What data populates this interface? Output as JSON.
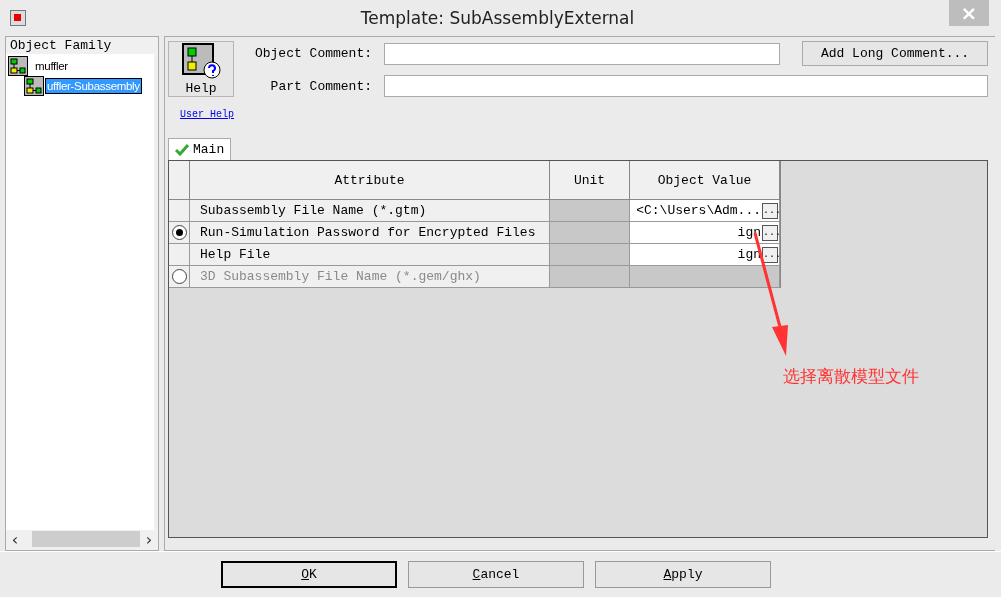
{
  "window": {
    "title": "Template: SubAssemblyExternal",
    "close": "×"
  },
  "family": {
    "title": "Object Family",
    "tree": [
      {
        "label": "muffler",
        "selected": false,
        "children": [
          {
            "label": "uffler-Subassembly",
            "selected": true
          }
        ]
      }
    ],
    "scroll_left": "‹",
    "scroll_right": "›"
  },
  "help": {
    "button": "Help",
    "link": "User Help"
  },
  "fields": [
    {
      "label": "Object Comment:"
    },
    {
      "label": "Part Comment:"
    }
  ],
  "long_comment_button": "Add Long Comment...",
  "tabs": [
    {
      "label": "Main",
      "selected": true
    }
  ],
  "table": {
    "columns": [
      "Attribute",
      "Unit",
      "Object Value"
    ],
    "rows": [
      {
        "kind": "plain",
        "attribute": "Subassembly File Name (*.gtm)",
        "value": "<C:\\Users\\Adm...",
        "browse": "...",
        "disabled": false
      },
      {
        "kind": "radio",
        "selected": true,
        "attribute": "Run-Simulation Password for Encrypted Files",
        "value": "ign",
        "browse": "...",
        "disabled": false
      },
      {
        "kind": "plain",
        "attribute": "Help File",
        "value": "ign",
        "browse": "...",
        "disabled": false
      },
      {
        "kind": "radio",
        "selected": false,
        "attribute": "3D Subassembly File Name (*.gem/ghx)",
        "disabled": true
      }
    ]
  },
  "annotation": {
    "text": "选择离散模型文件",
    "color": "#ff3333"
  },
  "buttons": [
    {
      "label": "OK",
      "default": true
    },
    {
      "label": "Cancel",
      "default": false
    },
    {
      "label": "Apply",
      "default": false
    }
  ]
}
